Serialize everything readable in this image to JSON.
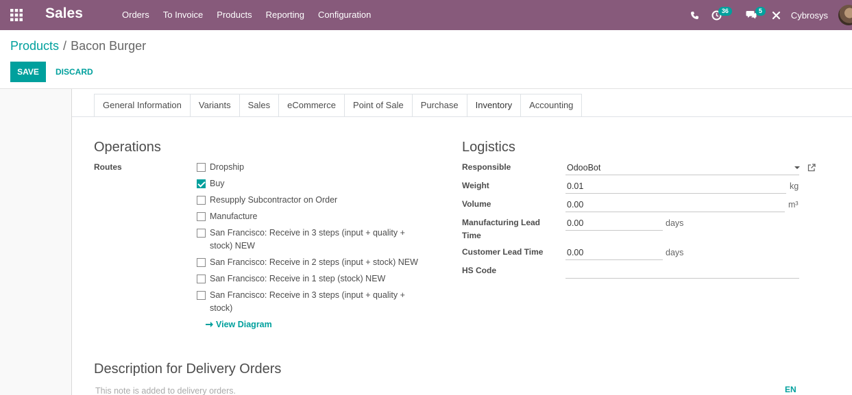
{
  "navbar": {
    "app_title": "Sales",
    "menu": [
      "Orders",
      "To Invoice",
      "Products",
      "Reporting",
      "Configuration"
    ],
    "activity_count": "36",
    "message_count": "5",
    "user_name": "Cybrosys",
    "bg_color": "#875a7b"
  },
  "breadcrumb": {
    "parent": "Products",
    "separator": "/",
    "current": "Bacon Burger"
  },
  "buttons": {
    "save": "SAVE",
    "discard": "DISCARD"
  },
  "tabs": [
    "General Information",
    "Variants",
    "Sales",
    "eCommerce",
    "Point of Sale",
    "Purchase",
    "Inventory",
    "Accounting"
  ],
  "active_tab": "Inventory",
  "operations": {
    "title": "Operations",
    "routes_label": "Routes",
    "routes": [
      {
        "label": "Dropship",
        "checked": false
      },
      {
        "label": "Buy",
        "checked": true
      },
      {
        "label": "Resupply Subcontractor on Order",
        "checked": false
      },
      {
        "label": "Manufacture",
        "checked": false
      },
      {
        "label": "San Francisco: Receive in 3 steps (input + quality + stock) NEW",
        "checked": false
      },
      {
        "label": "San Francisco: Receive in 2 steps (input + stock) NEW",
        "checked": false
      },
      {
        "label": "San Francisco: Receive in 1 step (stock) NEW",
        "checked": false
      },
      {
        "label": "San Francisco: Receive in 3 steps (input + quality + stock)",
        "checked": false
      }
    ],
    "view_diagram": "View Diagram"
  },
  "logistics": {
    "title": "Logistics",
    "responsible_label": "Responsible",
    "responsible_value": "OdooBot",
    "weight_label": "Weight",
    "weight_value": "0.01",
    "weight_unit": "kg",
    "volume_label": "Volume",
    "volume_value": "0.00",
    "volume_unit": "m³",
    "mfg_lead_label": "Manufacturing Lead Time",
    "mfg_lead_value": "0.00",
    "mfg_lead_unit": "days",
    "customer_lead_label": "Customer Lead Time",
    "customer_lead_value": "0.00",
    "customer_lead_unit": "days",
    "hs_code_label": "HS Code",
    "hs_code_value": ""
  },
  "description": {
    "title": "Description for Delivery Orders",
    "placeholder": "This note is added to delivery orders.",
    "lang": "EN"
  },
  "accent_color": "#00a09d"
}
